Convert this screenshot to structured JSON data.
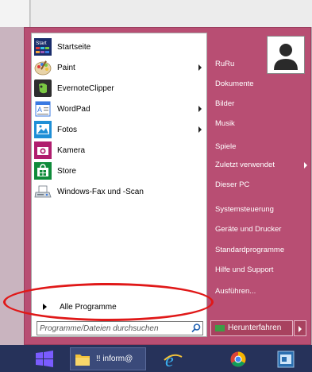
{
  "left_pane": {
    "programs": [
      {
        "label": "Startseite",
        "has_submenu": false,
        "icon": "startseite-icon"
      },
      {
        "label": "Paint",
        "has_submenu": true,
        "icon": "paint-palette-icon"
      },
      {
        "label": "EvernoteClipper",
        "has_submenu": false,
        "icon": "evernote-icon"
      },
      {
        "label": "WordPad",
        "has_submenu": true,
        "icon": "wordpad-icon"
      },
      {
        "label": "Fotos",
        "has_submenu": true,
        "icon": "photos-icon"
      },
      {
        "label": "Kamera",
        "has_submenu": false,
        "icon": "camera-icon"
      },
      {
        "label": "Store",
        "has_submenu": false,
        "icon": "store-icon"
      },
      {
        "label": "Windows-Fax und -Scan",
        "has_submenu": false,
        "icon": "fax-scan-icon"
      }
    ],
    "all_programs_label": "Alle Programme",
    "search_placeholder": "Programme/Dateien durchsuchen"
  },
  "right_pane": {
    "items": [
      {
        "label": "RuRu",
        "has_submenu": false
      },
      {
        "label": "Dokumente",
        "has_submenu": false
      },
      {
        "label": "Bilder",
        "has_submenu": false
      },
      {
        "label": "Musik",
        "has_submenu": false
      },
      {
        "label": "Spiele",
        "has_submenu": false
      },
      {
        "label": "Zuletzt verwendet",
        "has_submenu": true
      },
      {
        "label": "Dieser PC",
        "has_submenu": false
      },
      {
        "label": "Systemsteuerung",
        "has_submenu": false
      },
      {
        "label": "Geräte und Drucker",
        "has_submenu": false
      },
      {
        "label": "Standardprogramme",
        "has_submenu": false
      },
      {
        "label": "Hilfe und Support",
        "has_submenu": false
      },
      {
        "label": "Ausführen...",
        "has_submenu": false
      }
    ],
    "shutdown_label": "Herunterfahren"
  },
  "start_icon_text": "Start",
  "taskbar": {
    "folder_label": "!! inform@"
  },
  "colors": {
    "menu_background": "#b84e73",
    "highlight_ellipse": "#e01818",
    "taskbar": "#26325a"
  }
}
